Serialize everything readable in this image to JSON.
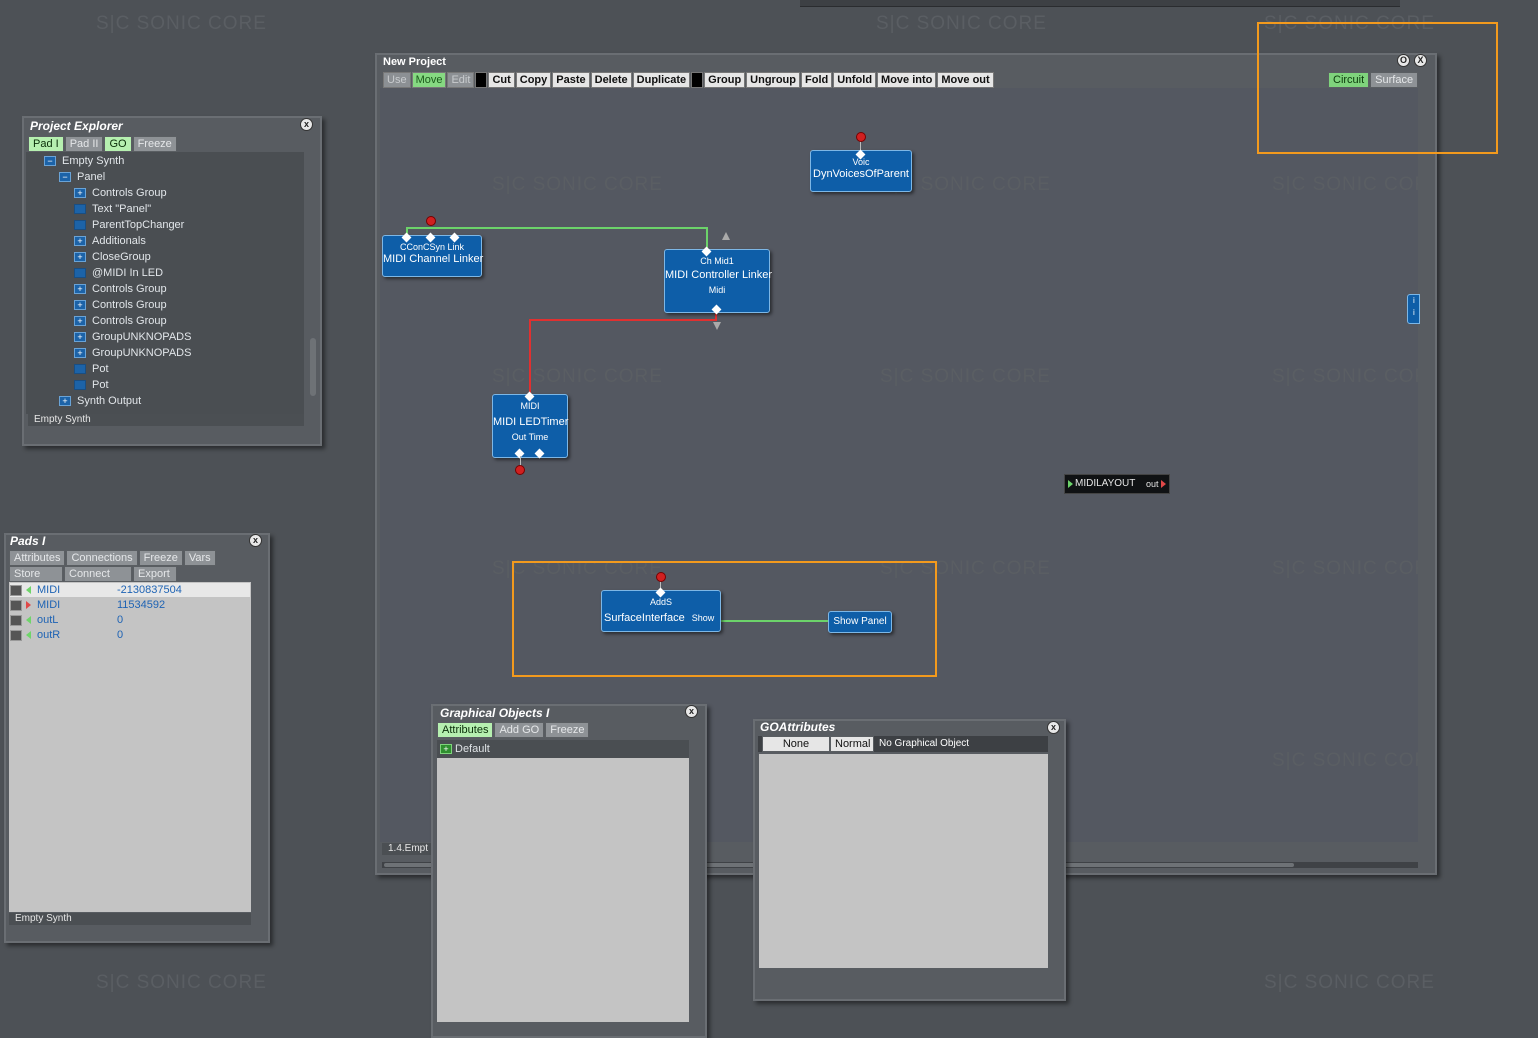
{
  "watermark": "S|C  SONIC CORE",
  "project_window": {
    "title": "New Project",
    "toolbar": [
      "Use",
      "Move",
      "Edit",
      "",
      "Cut",
      "Copy",
      "Paste",
      "Delete",
      "Duplicate",
      "",
      "Group",
      "Ungroup",
      "Fold",
      "Unfold",
      "Move into",
      "Move out"
    ],
    "view_tabs": [
      "Circuit",
      "Surface"
    ],
    "status": "1.4.Empt",
    "window_buttons": [
      "O",
      "X"
    ]
  },
  "modules": {
    "dynvoices": {
      "ports": "Voic",
      "name": "DynVoicesOfParent"
    },
    "midi_channel_linker": {
      "ports": "CConCSyn  Link",
      "name": "MIDI Channel Linker"
    },
    "midi_controller_linker": {
      "ports": "Ch  Mid1",
      "name": "MIDI Controller Linker",
      "outs": "Midi"
    },
    "midi_ledtimer": {
      "ports": "MIDI",
      "name": "MIDI LEDTimer",
      "outs": "Out  Time"
    },
    "midilayout": {
      "name": "MIDILAYOUT",
      "out": "out"
    },
    "surface_interface": {
      "ports": "AddS",
      "name": "SurfaceInterface",
      "outs": "Show"
    },
    "show_panel": {
      "name": "Show Panel"
    },
    "edge_module": {
      "a": "i",
      "b": "i"
    }
  },
  "project_explorer": {
    "title": "Project Explorer",
    "tabs": [
      "Pad I",
      "Pad II",
      "GO",
      "Freeze"
    ],
    "tree": [
      {
        "label": "Empty Synth",
        "type": "minus",
        "depth": 1
      },
      {
        "label": "Panel",
        "type": "minus",
        "depth": 2
      },
      {
        "label": "Controls Group",
        "type": "plus",
        "depth": 3
      },
      {
        "label": "Text \"Panel\"",
        "type": "leaf",
        "depth": 3
      },
      {
        "label": "ParentTopChanger",
        "type": "leaf",
        "depth": 3
      },
      {
        "label": "Additionals",
        "type": "plus",
        "depth": 3
      },
      {
        "label": "CloseGroup",
        "type": "plus",
        "depth": 3
      },
      {
        "label": "@MIDI In LED",
        "type": "leaf",
        "depth": 3
      },
      {
        "label": "Controls Group",
        "type": "plus",
        "depth": 3
      },
      {
        "label": "Controls Group",
        "type": "plus",
        "depth": 3
      },
      {
        "label": "Controls Group",
        "type": "plus",
        "depth": 3
      },
      {
        "label": "GroupUNKNOPADS",
        "type": "plus",
        "depth": 3
      },
      {
        "label": "GroupUNKNOPADS",
        "type": "plus",
        "depth": 3
      },
      {
        "label": "Pot",
        "type": "leaf",
        "depth": 3
      },
      {
        "label": "Pot",
        "type": "leaf",
        "depth": 3
      },
      {
        "label": "Synth Output",
        "type": "plus",
        "depth": 2
      }
    ],
    "status": "Empty Synth"
  },
  "pads": {
    "title": "Pads I",
    "tabs_row1": [
      "Attributes",
      "Connections",
      "Freeze",
      "Vars"
    ],
    "tabs_row2": [
      "Store",
      "Connect",
      "Export"
    ],
    "rows": [
      {
        "dir": "in",
        "name": "MIDI",
        "value": "-2130837504"
      },
      {
        "dir": "out",
        "name": "MIDI",
        "value": "11534592"
      },
      {
        "dir": "in",
        "name": "outL",
        "value": "0"
      },
      {
        "dir": "in",
        "name": "outR",
        "value": "0"
      }
    ],
    "status": "Empty Synth"
  },
  "graphical_objects": {
    "title": "Graphical Objects I",
    "tabs": [
      "Attributes",
      "Add GO",
      "Freeze"
    ],
    "items": [
      {
        "label": "Default"
      }
    ]
  },
  "go_attributes": {
    "title": "GOAttributes",
    "buttons": [
      "None",
      "Normal"
    ],
    "info": "No Graphical Object"
  },
  "colors": {
    "background": "#4d5156",
    "module": "#0e5ea8",
    "highlight": "#f39a1d",
    "wire_green": "#6cd36a",
    "wire_red": "#e03030"
  }
}
